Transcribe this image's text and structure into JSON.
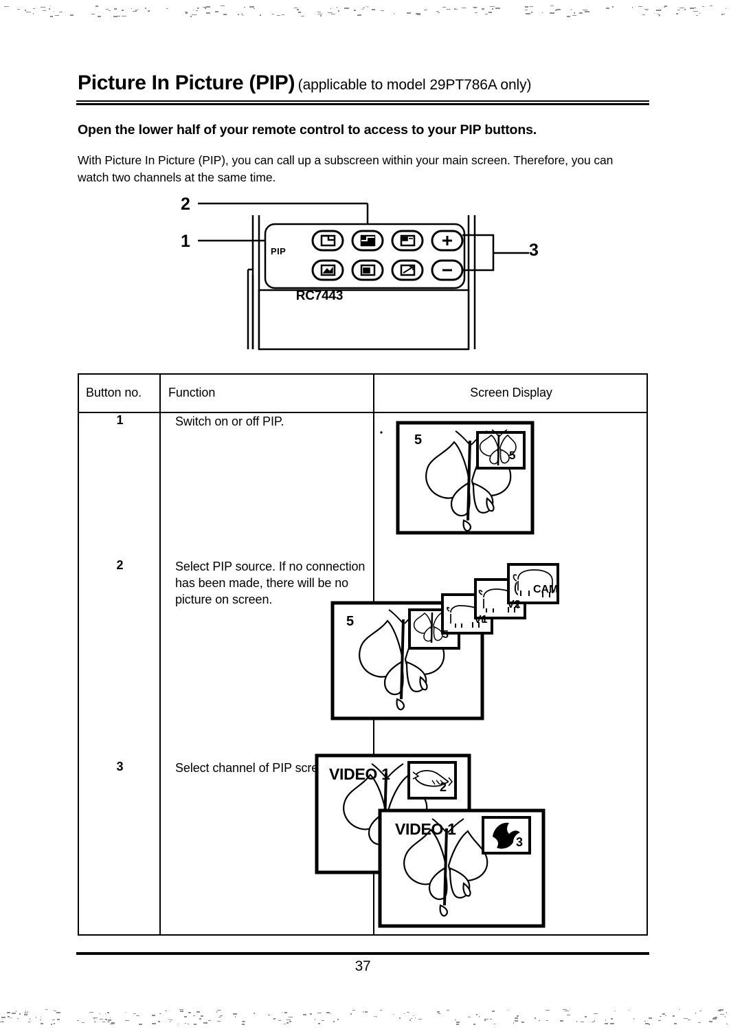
{
  "page": {
    "number": "37",
    "heading_main": "Picture In Picture (PIP)",
    "heading_sub": "(applicable to model 29PT786A only)",
    "lead": "Open the lower half of your remote control to access to your PIP buttons.",
    "body": "With Picture In Picture (PIP), you can call up a subscreen within your main screen. Therefore, you can watch two channels at the same time."
  },
  "remote_figure": {
    "model_label": "RC7443",
    "section_label": "PIP",
    "callouts": [
      {
        "id": "1",
        "label": "1"
      },
      {
        "id": "2",
        "label": "2"
      },
      {
        "id": "3",
        "label": "3"
      }
    ]
  },
  "table": {
    "headers": {
      "button_no": "Button no.",
      "function": "Function",
      "screen_display": "Screen Display"
    },
    "rows": [
      {
        "number": "1",
        "function": "Switch on or off PIP.",
        "screen_display": {
          "main_label": "5",
          "sub_label": "5"
        }
      },
      {
        "number": "2",
        "function": "Select PIP source. If no connection has been made, there will be no picture on screen.",
        "screen_display": {
          "main_label": "5",
          "source_labels": [
            "5",
            "V1",
            "V2",
            "CAM"
          ]
        }
      },
      {
        "number": "3",
        "function": "Select channel of PIP screen.",
        "screen_display": {
          "back_main_label": "VIDEO 1",
          "back_sub_label": "2",
          "front_main_label": "VIDEO 1",
          "front_sub_label": "3"
        }
      }
    ]
  }
}
